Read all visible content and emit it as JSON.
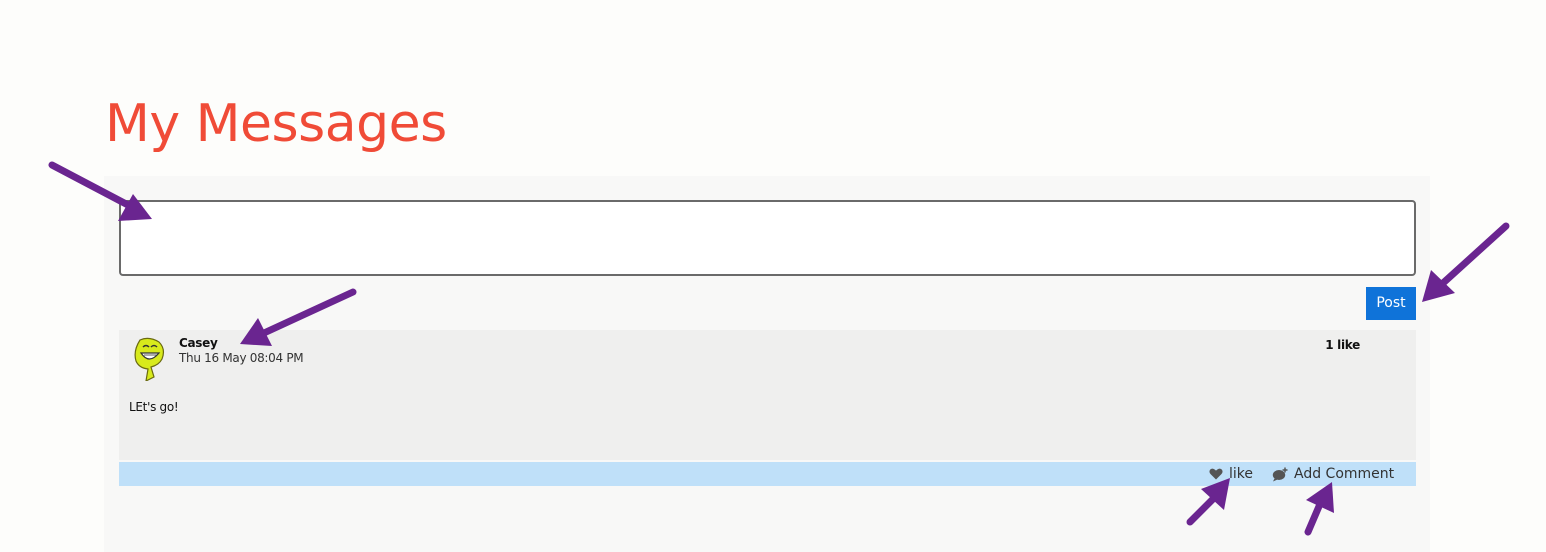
{
  "page": {
    "title": "My Messages"
  },
  "composer": {
    "value": "",
    "placeholder": ""
  },
  "post_button": {
    "label": "Post"
  },
  "post": {
    "author": "Casey",
    "timestamp": "Thu 16 May 08:04 PM",
    "likes_label": "1 like",
    "body": "LEt's go!",
    "avatar_icon": "smiley-avatar-icon"
  },
  "actions": {
    "like_label": "like",
    "like_icon": "heart-icon",
    "comment_label": "Add Comment",
    "comment_icon": "add-comment-icon"
  },
  "annotations": {
    "arrow_color": "#6a2590"
  },
  "colors": {
    "title": "#f04b37",
    "post_button": "#0f73d9",
    "action_bar": "#bfe0f9",
    "card": "#efefee"
  }
}
